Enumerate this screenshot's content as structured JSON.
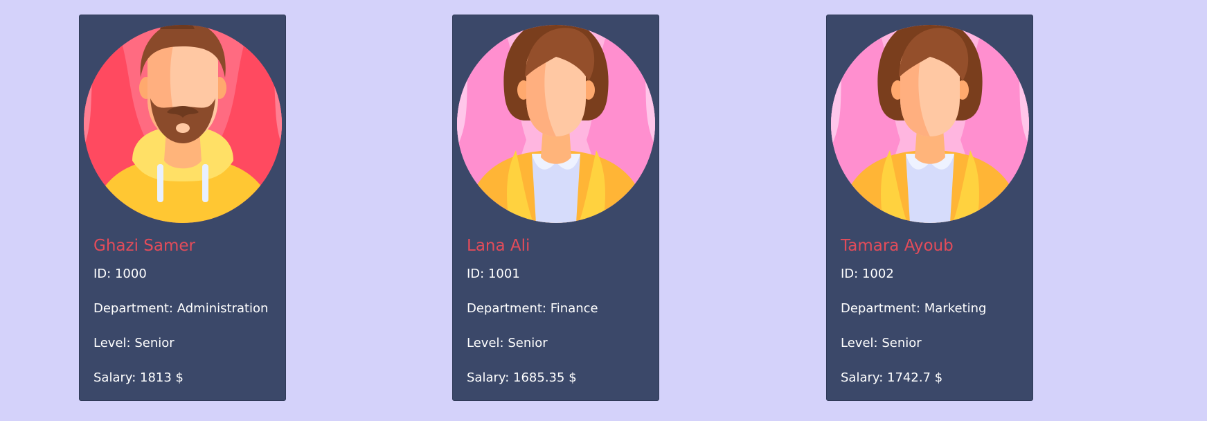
{
  "employees": [
    {
      "name": "Ghazi Samer",
      "id_label": "ID:",
      "id": "1000",
      "department_label": "Department:",
      "department": "Administration",
      "level_label": "Level:",
      "level": "Senior",
      "salary_label": "Salary:",
      "salary": "1813 $",
      "avatar": "male-avatar"
    },
    {
      "name": "Lana Ali",
      "id_label": "ID:",
      "id": "1001",
      "department_label": "Department:",
      "department": "Finance",
      "level_label": "Level:",
      "level": "Senior",
      "salary_label": "Salary:",
      "salary": "1685.35 $",
      "avatar": "female-avatar"
    },
    {
      "name": "Tamara Ayoub",
      "id_label": "ID:",
      "id": "1002",
      "department_label": "Department:",
      "department": "Marketing",
      "level_label": "Level:",
      "level": "Senior",
      "salary_label": "Salary:",
      "salary": "1742.7 $",
      "avatar": "female-avatar"
    }
  ],
  "colors": {
    "page_background": "#d4d2fa",
    "card_background": "#3b4869",
    "name_color": "#e34c5a",
    "text_color": "#ffffff"
  }
}
